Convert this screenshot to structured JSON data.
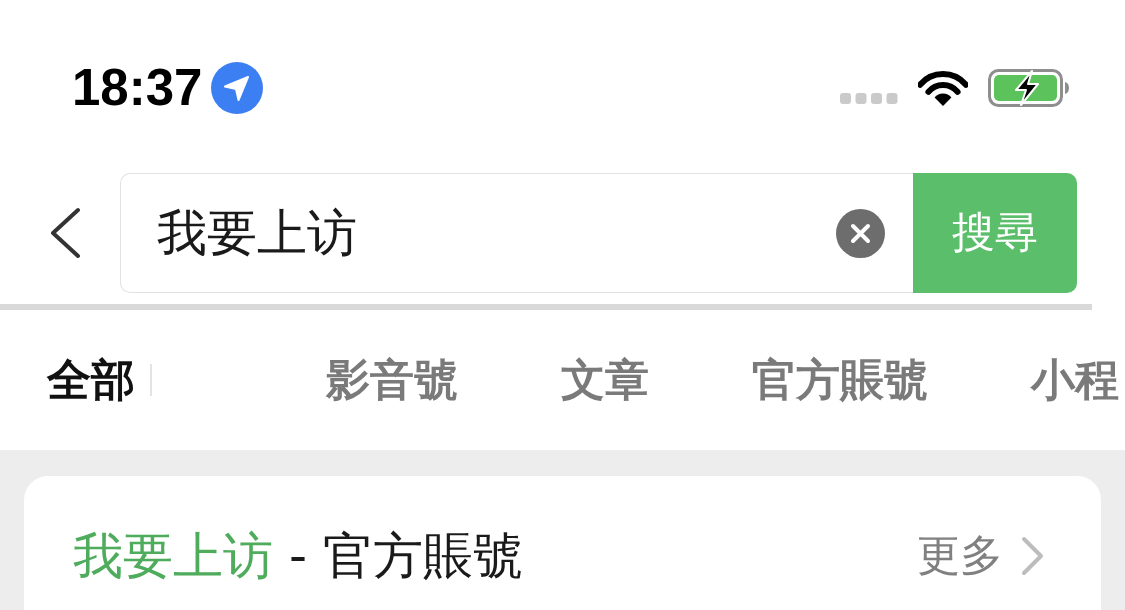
{
  "status_bar": {
    "time": "18:37"
  },
  "search": {
    "value": "我要上访",
    "button": "搜尋"
  },
  "tabs": [
    {
      "label": "全部",
      "selected": true
    },
    {
      "label": "影音號",
      "selected": false
    },
    {
      "label": "文章",
      "selected": false
    },
    {
      "label": "官方賬號",
      "selected": false
    },
    {
      "label": "小程",
      "selected": false
    }
  ],
  "result_card": {
    "title": {
      "highlight": "我要上访",
      "text": " - 官方賬號"
    },
    "more": "更多"
  }
}
